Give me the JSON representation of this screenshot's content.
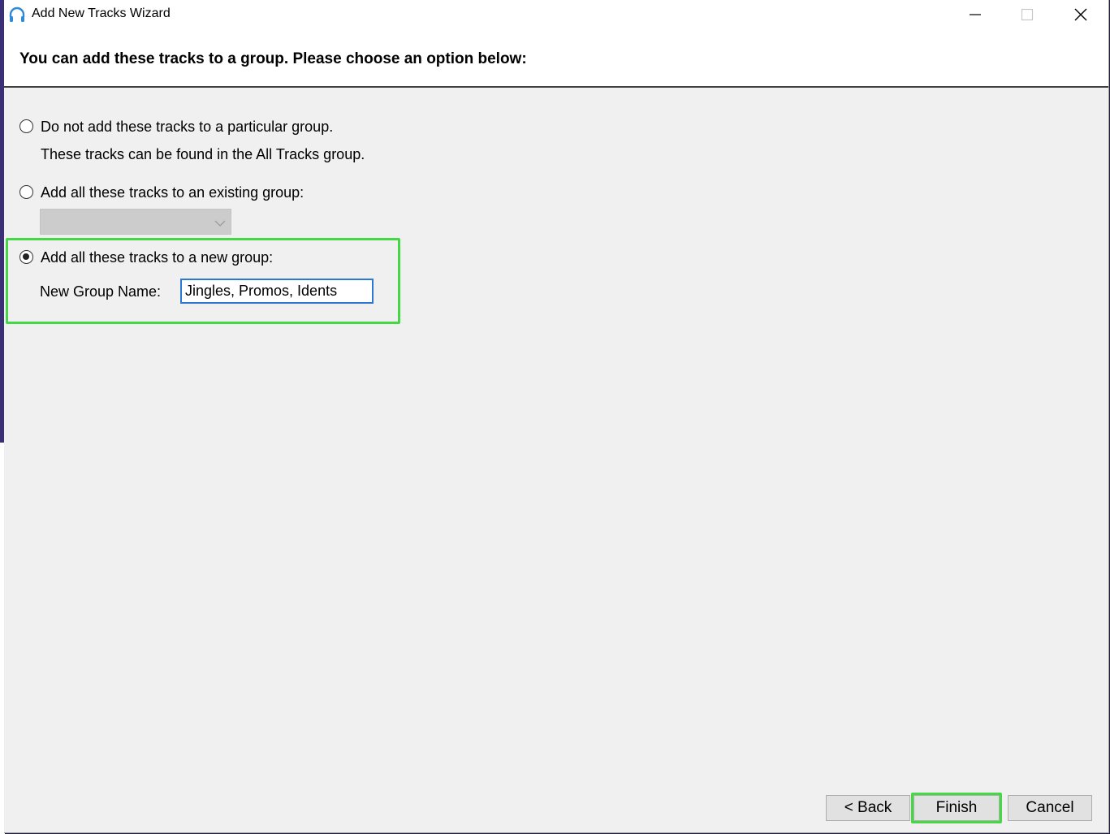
{
  "window": {
    "title": "Add New Tracks Wizard",
    "icon": "headphones-icon"
  },
  "header": {
    "text": "You can add these tracks to a group. Please choose an option below:"
  },
  "options": {
    "no_group": {
      "label": "Do not add these tracks to a particular group.",
      "sublabel": "These tracks can be found in the All Tracks group.",
      "selected": false
    },
    "existing_group": {
      "label": "Add all these tracks to an existing group:",
      "selected": false,
      "value": ""
    },
    "new_group": {
      "label": "Add all these tracks to a new group:",
      "selected": true,
      "name_label": "New Group Name:",
      "name_value": "Jingles, Promos, Idents"
    }
  },
  "buttons": {
    "back": "< Back",
    "finish": "Finish",
    "cancel": "Cancel"
  },
  "colors": {
    "highlight": "#44d944",
    "input_focus": "#2a7ad4"
  }
}
